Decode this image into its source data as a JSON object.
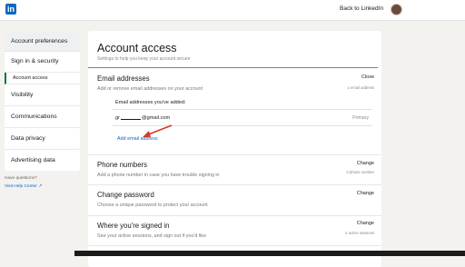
{
  "topbar": {
    "logo": "in",
    "back_link": "Back to LinkedIn"
  },
  "sidebar": {
    "header": "Account preferences",
    "items": [
      {
        "label": "Sign in & security"
      },
      {
        "label": "Account access"
      },
      {
        "label": "Visibility"
      },
      {
        "label": "Communications"
      },
      {
        "label": "Data privacy"
      },
      {
        "label": "Advertising data"
      }
    ],
    "help_question": "Have questions?",
    "help_link": "Visit Help Center"
  },
  "main": {
    "title": "Account access",
    "subtitle": "Settings to help you keep your account secure",
    "sections": [
      {
        "title": "Email addresses",
        "description": "Add or remove email addresses on your account",
        "action": "Close",
        "meta": "1 email address",
        "emails_heading": "Email addresses you've added:",
        "email_prefix": "gr",
        "email_suffix": "@gmail.com",
        "primary_label": "Primary",
        "add_label": "Add email address"
      },
      {
        "title": "Phone numbers",
        "description": "Add a phone number in case you have trouble signing in",
        "action": "Change",
        "meta": "0 phone number"
      },
      {
        "title": "Change password",
        "description": "Choose a unique password to protect your account",
        "action": "Change"
      },
      {
        "title": "Where you're signed in",
        "description": "See your active sessions, and sign out if you'd like",
        "action": "Change",
        "meta": "4 active sessions"
      }
    ]
  },
  "colors": {
    "brand": "#0a66c2",
    "active_indicator": "#057642",
    "annotation_arrow": "#d63a2a"
  }
}
